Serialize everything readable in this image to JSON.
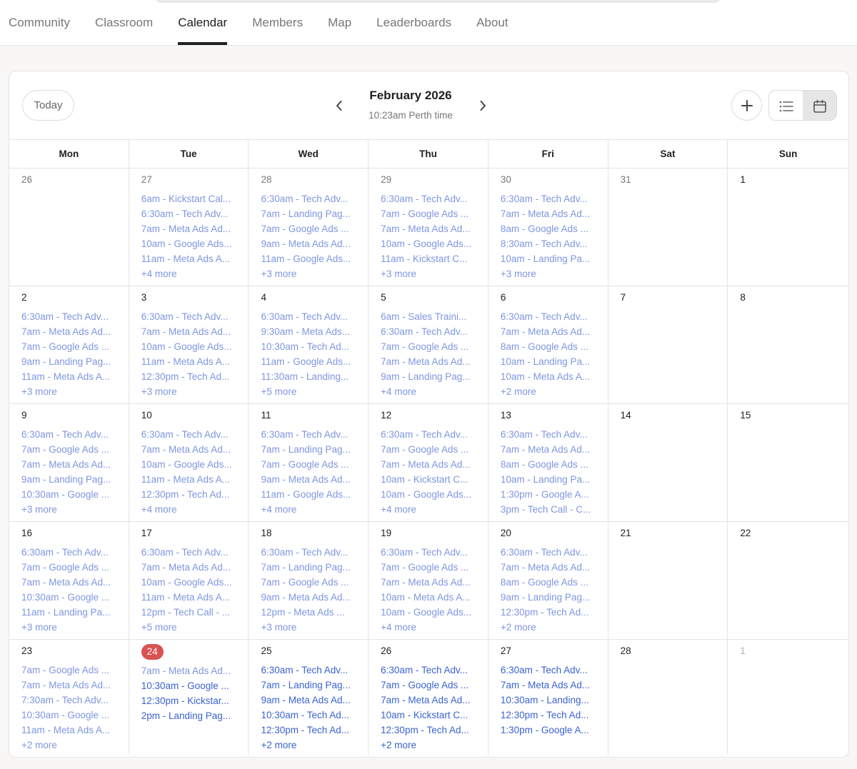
{
  "nav": {
    "tabs": [
      {
        "label": "Community",
        "active": false
      },
      {
        "label": "Classroom",
        "active": false
      },
      {
        "label": "Calendar",
        "active": true
      },
      {
        "label": "Members",
        "active": false
      },
      {
        "label": "Map",
        "active": false
      },
      {
        "label": "Leaderboards",
        "active": false
      },
      {
        "label": "About",
        "active": false
      }
    ]
  },
  "header": {
    "today_label": "Today",
    "month_title": "February 2026",
    "time_label": "10:23am Perth time",
    "icons": {
      "prev": "chevron-left-icon",
      "next": "chevron-right-icon",
      "add": "plus-icon",
      "list_view": "list-icon",
      "month_view": "calendar-icon"
    }
  },
  "weekdays": [
    "Mon",
    "Tue",
    "Wed",
    "Thu",
    "Fri",
    "Sat",
    "Sun"
  ],
  "colors": {
    "past_event": "#7f96e0",
    "future_event": "#3b63d1",
    "today_badge": "#d9534f"
  },
  "weeks": [
    [
      {
        "num": "26",
        "state": "muted",
        "events": [],
        "more": ""
      },
      {
        "num": "27",
        "state": "muted",
        "events": [
          "6am - Kickstart Cal...",
          "6:30am - Tech Adv...",
          "7am - Meta Ads Ad...",
          "10am - Google Ads...",
          "11am - Meta Ads A..."
        ],
        "more": "+4 more"
      },
      {
        "num": "28",
        "state": "muted",
        "events": [
          "6:30am - Tech Adv...",
          "7am - Landing Pag...",
          "7am - Google Ads ...",
          "9am - Meta Ads Ad...",
          "11am - Google Ads..."
        ],
        "more": "+3 more"
      },
      {
        "num": "29",
        "state": "muted",
        "events": [
          "6:30am - Tech Adv...",
          "7am - Google Ads ...",
          "7am - Meta Ads Ad...",
          "10am - Google Ads...",
          "11am - Kickstart C..."
        ],
        "more": "+3 more"
      },
      {
        "num": "30",
        "state": "muted",
        "events": [
          "6:30am - Tech Adv...",
          "7am - Meta Ads Ad...",
          "8am - Google Ads ...",
          "8:30am - Tech Adv...",
          "10am - Landing Pa..."
        ],
        "more": "+3 more"
      },
      {
        "num": "31",
        "state": "muted",
        "events": [],
        "more": ""
      },
      {
        "num": "1",
        "state": "normal",
        "events": [],
        "more": ""
      }
    ],
    [
      {
        "num": "2",
        "state": "normal",
        "events": [
          "6:30am - Tech Adv...",
          "7am - Meta Ads Ad...",
          "7am - Google Ads ...",
          "9am - Landing Pag...",
          "11am - Meta Ads A..."
        ],
        "more": "+3 more"
      },
      {
        "num": "3",
        "state": "normal",
        "events": [
          "6:30am - Tech Adv...",
          "7am - Meta Ads Ad...",
          "10am - Google Ads...",
          "11am - Meta Ads A...",
          "12:30pm - Tech Ad..."
        ],
        "more": "+3 more"
      },
      {
        "num": "4",
        "state": "normal",
        "events": [
          "6:30am - Tech Adv...",
          "9:30am - Meta Ads...",
          "10:30am - Tech Ad...",
          "11am - Google Ads...",
          "11:30am - Landing..."
        ],
        "more": "+5 more"
      },
      {
        "num": "5",
        "state": "normal",
        "events": [
          "6am - Sales Traini...",
          "6:30am - Tech Adv...",
          "7am - Google Ads ...",
          "7am - Meta Ads Ad...",
          "9am - Landing Pag..."
        ],
        "more": "+4 more"
      },
      {
        "num": "6",
        "state": "normal",
        "events": [
          "6:30am - Tech Adv...",
          "7am - Meta Ads Ad...",
          "8am - Google Ads ...",
          "10am - Landing Pa...",
          "10am - Meta Ads A..."
        ],
        "more": "+2 more"
      },
      {
        "num": "7",
        "state": "normal",
        "events": [],
        "more": ""
      },
      {
        "num": "8",
        "state": "normal",
        "events": [],
        "more": ""
      }
    ],
    [
      {
        "num": "9",
        "state": "normal",
        "events": [
          "6:30am - Tech Adv...",
          "7am - Google Ads ...",
          "7am - Meta Ads Ad...",
          "9am - Landing Pag...",
          "10:30am - Google ..."
        ],
        "more": "+3 more"
      },
      {
        "num": "10",
        "state": "normal",
        "events": [
          "6:30am - Tech Adv...",
          "7am - Meta Ads Ad...",
          "10am - Google Ads...",
          "11am - Meta Ads A...",
          "12:30pm - Tech Ad..."
        ],
        "more": "+4 more"
      },
      {
        "num": "11",
        "state": "normal",
        "events": [
          "6:30am - Tech Adv...",
          "7am - Landing Pag...",
          "7am - Google Ads ...",
          "9am - Meta Ads Ad...",
          "11am - Google Ads..."
        ],
        "more": "+4 more"
      },
      {
        "num": "12",
        "state": "normal",
        "events": [
          "6:30am - Tech Adv...",
          "7am - Google Ads ...",
          "7am - Meta Ads Ad...",
          "10am - Kickstart C...",
          "10am - Google Ads..."
        ],
        "more": "+4 more"
      },
      {
        "num": "13",
        "state": "normal",
        "events": [
          "6:30am - Tech Adv...",
          "7am - Meta Ads Ad...",
          "8am - Google Ads ...",
          "10am - Landing Pa...",
          "1:30pm - Google A...",
          "3pm - Tech Call - C..."
        ],
        "more": ""
      },
      {
        "num": "14",
        "state": "normal",
        "events": [],
        "more": ""
      },
      {
        "num": "15",
        "state": "normal",
        "events": [],
        "more": ""
      }
    ],
    [
      {
        "num": "16",
        "state": "normal",
        "events": [
          "6:30am - Tech Adv...",
          "7am - Google Ads ...",
          "7am - Meta Ads Ad...",
          "10:30am - Google ...",
          "11am - Landing Pa..."
        ],
        "more": "+3 more"
      },
      {
        "num": "17",
        "state": "normal",
        "events": [
          "6:30am - Tech Adv...",
          "7am - Meta Ads Ad...",
          "10am - Google Ads...",
          "11am - Meta Ads A...",
          "12pm - Tech Call - ..."
        ],
        "more": "+5 more"
      },
      {
        "num": "18",
        "state": "normal",
        "events": [
          "6:30am - Tech Adv...",
          "7am - Landing Pag...",
          "7am - Google Ads ...",
          "9am - Meta Ads Ad...",
          "12pm - Meta Ads ..."
        ],
        "more": "+3 more"
      },
      {
        "num": "19",
        "state": "normal",
        "events": [
          "6:30am - Tech Adv...",
          "7am - Google Ads ...",
          "7am - Meta Ads Ad...",
          "10am - Meta Ads A...",
          "10am - Google Ads..."
        ],
        "more": "+4 more"
      },
      {
        "num": "20",
        "state": "normal",
        "events": [
          "6:30am - Tech Adv...",
          "7am - Meta Ads Ad...",
          "8am - Google Ads ...",
          "9am - Landing Pag...",
          "12:30pm - Tech Ad..."
        ],
        "more": "+2 more"
      },
      {
        "num": "21",
        "state": "normal",
        "events": [],
        "more": ""
      },
      {
        "num": "22",
        "state": "normal",
        "events": [],
        "more": ""
      }
    ],
    [
      {
        "num": "23",
        "state": "normal",
        "events": [
          "7am - Google Ads ...",
          "7am - Meta Ads Ad...",
          "7:30am - Tech Adv...",
          "10:30am - Google ...",
          "11am - Meta Ads A..."
        ],
        "more": "+2 more"
      },
      {
        "num": "24",
        "state": "today",
        "events": [
          "7am - Meta Ads Ad...",
          "10:30am - Google ...",
          "12:30pm - Kickstar...",
          "2pm - Landing Pag..."
        ],
        "future_from": 1,
        "more": ""
      },
      {
        "num": "25",
        "state": "normal",
        "future": true,
        "events": [
          "6:30am - Tech Adv...",
          "7am - Landing Pag...",
          "9am - Meta Ads Ad...",
          "10:30am - Tech Ad...",
          "12:30pm - Tech Ad..."
        ],
        "more": "+2 more"
      },
      {
        "num": "26",
        "state": "normal",
        "future": true,
        "events": [
          "6:30am - Tech Adv...",
          "7am - Google Ads ...",
          "7am - Meta Ads Ad...",
          "10am - Kickstart C...",
          "12:30pm - Tech Ad..."
        ],
        "more": "+2 more"
      },
      {
        "num": "27",
        "state": "normal",
        "future": true,
        "events": [
          "6:30am - Tech Adv...",
          "7am - Meta Ads Ad...",
          "10:30am - Landing...",
          "12:30pm - Tech Ad...",
          "1:30pm - Google A..."
        ],
        "more": ""
      },
      {
        "num": "28",
        "state": "normal",
        "events": [],
        "more": ""
      },
      {
        "num": "1",
        "state": "faint",
        "events": [],
        "more": ""
      }
    ]
  ]
}
